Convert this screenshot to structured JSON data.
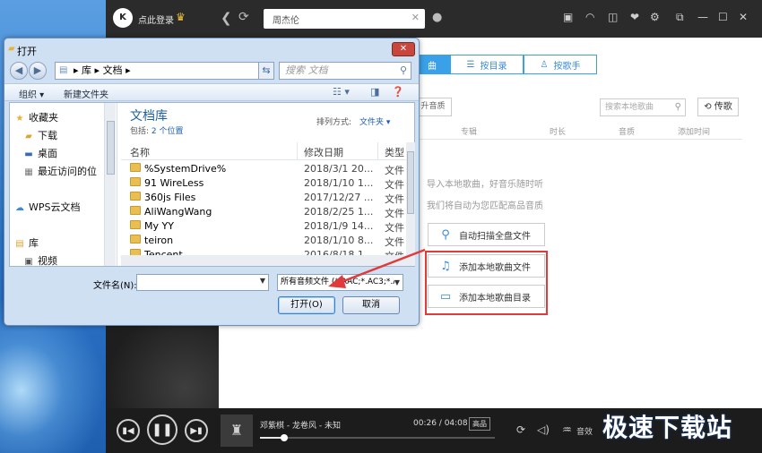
{
  "app": {
    "login_label": "点此登录",
    "search_value": "周杰伦",
    "tabs": [
      {
        "label": "曲"
      },
      {
        "label": "按目录"
      },
      {
        "label": "按歌手"
      }
    ],
    "local_search_placeholder": "搜索本地歌曲",
    "upload_label": "传歌",
    "upload_quality_label": "升音质",
    "columns": [
      "专辑",
      "时长",
      "音质",
      "添加时间"
    ],
    "import_msg": "导入本地歌曲，好音乐随时听",
    "match_msg": "我们将自动为您匹配高品音质",
    "scan_label": "自动扫描全盘文件",
    "add_file_label": "添加本地歌曲文件",
    "add_dir_label": "添加本地歌曲目录"
  },
  "player": {
    "song": "邓紫棋 - 龙卷风 - 未知",
    "time": "00:26 / 04:08",
    "quality": "高品",
    "effect_label": "音效",
    "progress": 0.1048
  },
  "dialog": {
    "title": "打开",
    "address": [
      "库",
      "文档"
    ],
    "search_placeholder": "搜索 文档",
    "organize_label": "组织 ▾",
    "new_folder_label": "新建文件夹",
    "nav_items": [
      {
        "label": "收藏夹",
        "icon": "star-icon"
      },
      {
        "label": "下载",
        "icon": "folder-icon"
      },
      {
        "label": "桌面",
        "icon": "desktop-icon"
      },
      {
        "label": "最近访问的位",
        "icon": "recent-icon"
      },
      {
        "label": "WPS云文档",
        "icon": "cloud-icon"
      },
      {
        "label": "库",
        "icon": "library-icon"
      },
      {
        "label": "视频",
        "icon": "video-icon"
      }
    ],
    "library_title": "文档库",
    "includes_prefix": "包括: ",
    "includes_link": "2 个位置",
    "sort_label": "排列方式:",
    "sort_value": "文件夹 ▾",
    "headers": {
      "name": "名称",
      "date": "修改日期",
      "type": "类型"
    },
    "files": [
      {
        "name": "%SystemDrive%",
        "date": "2018/3/1 20...",
        "type": "文件"
      },
      {
        "name": "91 WireLess",
        "date": "2018/1/10 1...",
        "type": "文件"
      },
      {
        "name": "360js Files",
        "date": "2017/12/27 ...",
        "type": "文件"
      },
      {
        "name": "AliWangWang",
        "date": "2018/2/25 1...",
        "type": "文件"
      },
      {
        "name": "My YY",
        "date": "2018/1/9 14...",
        "type": "文件"
      },
      {
        "name": "teiron",
        "date": "2018/1/10 8...",
        "type": "文件"
      },
      {
        "name": "Tencent",
        "date": "2016/8/18 1...",
        "type": "文件"
      }
    ],
    "filename_label": "文件名(N):",
    "filename_value": "",
    "filter_value": "所有音频文件 (*.AAC;*.AC3;*.A",
    "open_label": "打开(O)",
    "cancel_label": "取消"
  },
  "watermark": "极速下载站",
  "colors": {
    "accent": "#3aa0e8",
    "highlight": "#e23a3a",
    "titlebar": "#2b2b2b"
  }
}
